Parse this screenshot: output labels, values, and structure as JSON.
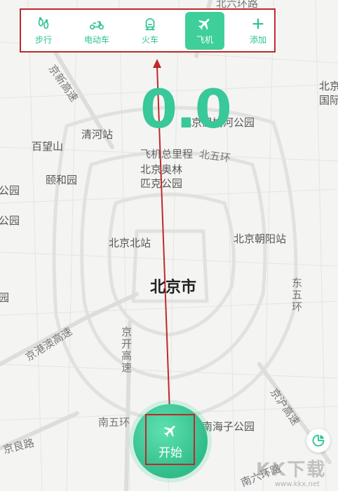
{
  "modes": [
    {
      "label": "步行",
      "icon": "footprints-icon",
      "active": false
    },
    {
      "label": "电动车",
      "icon": "scooter-icon",
      "active": false
    },
    {
      "label": "火车",
      "icon": "train-icon",
      "active": false
    },
    {
      "label": "飞机",
      "icon": "airplane-icon",
      "active": true
    },
    {
      "label": "添加",
      "icon": "plus-icon",
      "active": false
    }
  ],
  "distance": {
    "value": "0.0",
    "label": "飞机总里程"
  },
  "start_button": {
    "label": "开始",
    "icon": "airplane-icon"
  },
  "stats_button": {
    "icon": "pie-chart-icon"
  },
  "map": {
    "city": "北京市",
    "places": [
      "北六环路",
      "北京",
      "国际",
      "京新高速",
      "北京温榆河公园",
      "清河站",
      "百望山",
      "北五环",
      "北京奥林匹克公园",
      "颐和园",
      "公园",
      "公园",
      "北京北站",
      "北京朝阳站",
      "东五环",
      "园",
      "京港澳高速",
      "京开高速",
      "南五环",
      "南海子公园",
      "京沪高速",
      "京良路",
      "南六环路"
    ]
  },
  "watermark": {
    "text": "KK下载",
    "url": "www.kkx.net"
  },
  "colors": {
    "accent": "#3ecf9b",
    "accent_text": "#29c48e",
    "annotation": "#c0282c"
  }
}
